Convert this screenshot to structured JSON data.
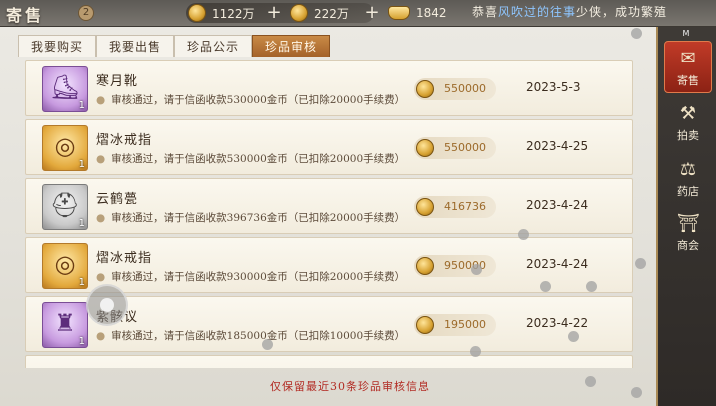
{
  "header": {
    "title": "寄售",
    "back_badge": "2",
    "currencies": [
      {
        "name": "copper",
        "amount": "1122万"
      },
      {
        "name": "silver",
        "amount": "222万"
      },
      {
        "name": "ingot",
        "amount": "1842"
      }
    ],
    "ticker": {
      "prefix": "恭喜",
      "highlight": "风吹过的往事",
      "suffix": "少侠，成功繁殖"
    }
  },
  "tabs": [
    {
      "label": "我要购买",
      "active": false
    },
    {
      "label": "我要出售",
      "active": false
    },
    {
      "label": "珍品公示",
      "active": false
    },
    {
      "label": "珍品审核",
      "active": true
    }
  ],
  "rows": [
    {
      "name": "寒月靴",
      "status": "审核通过，请于信函收款530000金币（已扣除20000手续费）",
      "price": "550000",
      "date": "2023-5-3",
      "qty": "1",
      "icon": "boots-icon",
      "rarity": "purple"
    },
    {
      "name": "熠冰戒指",
      "status": "审核通过，请于信函收款530000金币（已扣除20000手续费）",
      "price": "550000",
      "date": "2023-4-25",
      "qty": "1",
      "icon": "ring-icon",
      "rarity": "gold"
    },
    {
      "name": "云鹤甍",
      "status": "审核通过，请于信函收款396736金币（已扣除20000手续费）",
      "price": "416736",
      "date": "2023-4-24",
      "qty": "1",
      "icon": "helmet-icon",
      "rarity": "grey"
    },
    {
      "name": "熠冰戒指",
      "status": "审核通过，请于信函收款930000金币（已扣除20000手续费）",
      "price": "950000",
      "date": "2023-4-24",
      "qty": "1",
      "icon": "ring-icon",
      "rarity": "gold"
    },
    {
      "name": "紫骸议",
      "status": "审核通过，请于信函收款185000金币（已扣除10000手续费）",
      "price": "195000",
      "date": "2023-4-22",
      "qty": "1",
      "icon": "armor-icon",
      "rarity": "purple"
    }
  ],
  "footer_note": "仅保留最近30条珍品审核信息",
  "sidebar": {
    "top_label": "M",
    "items": [
      {
        "label": "寄售",
        "icon": "scroll-icon",
        "active": true
      },
      {
        "label": "拍卖",
        "icon": "gavel-icon",
        "active": false
      },
      {
        "label": "药店",
        "icon": "scale-icon",
        "active": false
      },
      {
        "label": "商会",
        "icon": "shop-icon",
        "active": false
      }
    ]
  },
  "colors": {
    "accent": "#a4622a",
    "warning": "#b22b23",
    "sidebar_active": "#c13b28"
  }
}
